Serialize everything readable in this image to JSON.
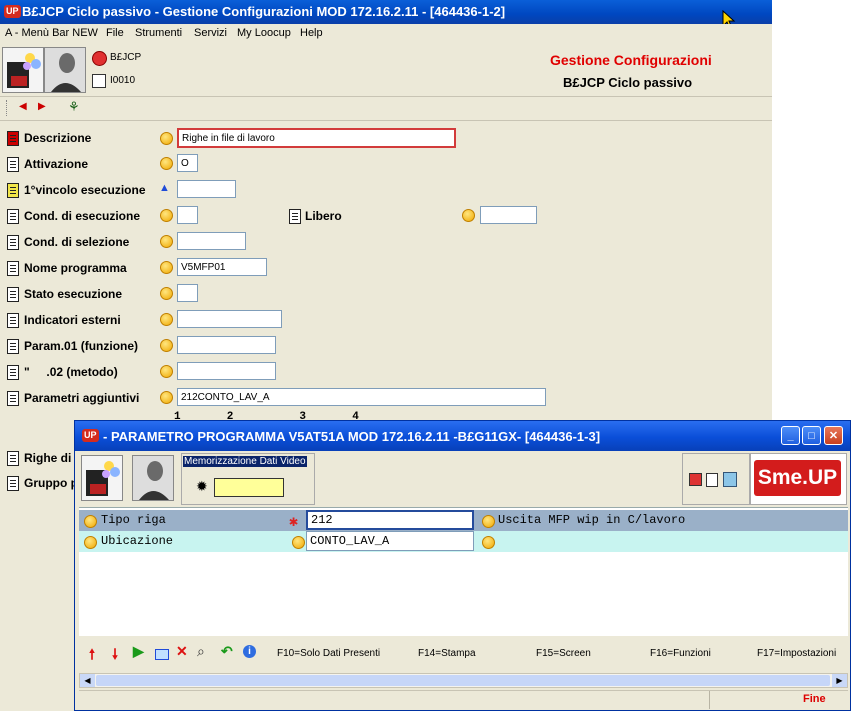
{
  "main_window": {
    "title": "B£JCP Ciclo passivo - Gestione Configurazioni MOD 172.16.2.11 - [464436-1-2]",
    "app_badge": "UP",
    "menu": [
      "A - Menù Bar NEW",
      "File",
      "Strumenti",
      "Servizi",
      "My Loocup",
      "Help"
    ],
    "header": {
      "code1": "B£JCP",
      "code2": "I0010",
      "heading": "Gestione Configurazioni",
      "subheading": "B£JCP Ciclo passivo",
      "heading_color": "#e00000"
    },
    "form": {
      "descrizione_label": "Descrizione",
      "descrizione_value": "Righe in file di lavoro",
      "attivazione_label": "Attivazione",
      "attivazione_value": "O",
      "vincolo_label": "1°vincolo esecuzione",
      "vincolo_value": "",
      "cond_esec_label": "Cond. di esecuzione",
      "cond_esec_value": "",
      "libero_label": "Libero",
      "libero_value": "",
      "cond_sel_label": "Cond. di selezione",
      "cond_sel_value": "",
      "nome_prog_label": "Nome programma",
      "nome_prog_value": "V5MFP01",
      "stato_label": "Stato esecuzione",
      "stato_value": "",
      "indicatori_label": "Indicatori esterni",
      "indicatori_value": "",
      "param01_label": "Param.01 (funzione)",
      "param01_value": "",
      "param02_label": "\"     .02 (metodo)",
      "param02_value": "",
      "parametri_label": "Parametri aggiuntivi",
      "parametri_value": "212CONTO_LAV_A",
      "ruler": "1       2          3       4",
      "righe_label": "Righe di s",
      "gruppo_label": "Gruppo p"
    }
  },
  "popup": {
    "title": "- PARAMETRO PROGRAMMA V5AT51A MOD 172.16.2.11 -B£G11GX- [464436-1-3]",
    "app_badge": "UP",
    "memo_label": "Memorizzazione Dati Video",
    "memo_value": "",
    "brand": "Sme.UP",
    "rows": [
      {
        "label": "Tipo riga",
        "value": "212",
        "desc": "Uscita MFP wip in C/lavoro"
      },
      {
        "label": "Ubicazione",
        "value": "CONTO_LAV_A",
        "desc": ""
      }
    ],
    "fkeys": [
      "F10=Solo Dati Presenti",
      "F14=Stampa",
      "F15=Screen",
      "F16=Funzioni",
      "F17=Impostazioni"
    ],
    "status": "Fine",
    "row_colors": {
      "selected": "#9ab0c8",
      "alt": "#c8f4f0"
    }
  }
}
